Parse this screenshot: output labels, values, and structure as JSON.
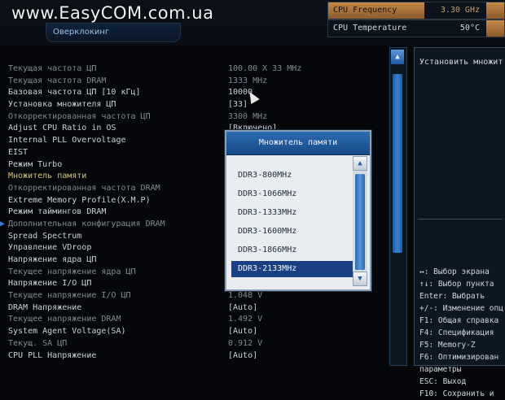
{
  "watermark": "www.EasyCOM.com.ua",
  "section_tab": "Оверклокинг",
  "status": {
    "cpu_frequency": {
      "label": "CPU Frequency",
      "value": "3.30 GHz"
    },
    "cpu_temperature": {
      "label": "CPU Temperature",
      "value": "50°C"
    }
  },
  "settings": [
    {
      "name": "Текущая частота ЦП",
      "value": "100.00 X 33 MHz"
    },
    {
      "name": "Текущая частота DRAM",
      "value": "1333 MHz"
    },
    {
      "name": "Базовая частота ЦП [10 кГц]",
      "value": "10000"
    },
    {
      "name": "Установка множителя ЦП",
      "value": "[33]"
    },
    {
      "name": "Откорректированная частота ЦП",
      "value": "3300 MHz"
    },
    {
      "name": "Adjust CPU Ratio in OS",
      "value": "[Включено]"
    },
    {
      "name": "Internal PLL Overvoltage",
      "value": ""
    },
    {
      "name": "EIST",
      "value": ""
    },
    {
      "name": "Режим Turbo",
      "value": ""
    },
    {
      "name": "Множитель памяти",
      "value": ""
    },
    {
      "name": "Откорректированная частота DRAM",
      "value": ""
    },
    {
      "name": "Extreme Memory Profile(X.M.P)",
      "value": ""
    },
    {
      "name": "Режим таймингов DRAM",
      "value": ""
    },
    {
      "name": "Дополнительная конфигурация DRAM",
      "value": ""
    },
    {
      "name": "Spread Spectrum",
      "value": ""
    },
    {
      "name": "Управление VDroop",
      "value": ""
    },
    {
      "name": "Напряжение ядра ЦП",
      "value": ""
    },
    {
      "name": "Текущее напряжение ядра ЦП",
      "value": ""
    },
    {
      "name": "Напряжение I/O ЦП",
      "value": ""
    },
    {
      "name": "Текущее напряжение I/O ЦП",
      "value": "1.048 V"
    },
    {
      "name": "DRAM Напряжение",
      "value": "[Auto]"
    },
    {
      "name": "Текущее напряжение DRAM",
      "value": "1.492 V"
    },
    {
      "name": "System Agent Voltage(SA)",
      "value": "[Auto]"
    },
    {
      "name": "Текущ. SA ЦП",
      "value": "0.912 V"
    },
    {
      "name": "CPU PLL Напряжение",
      "value": "[Auto]"
    }
  ],
  "popup": {
    "title": "Множитель памяти",
    "options": [
      "DDR3-800MHz",
      "DDR3-1066MHz",
      "DDR3-1333MHz",
      "DDR3-1600MHz",
      "DDR3-1866MHz",
      "DDR3-2133MHz"
    ],
    "selected": "DDR3-2133MHz"
  },
  "help": {
    "description": "Установить множит",
    "legend": [
      "↔: Выбор экрана",
      "↑↓: Выбор пункта",
      "Enter: Выбрать",
      "+/-: Изменение опц",
      "F1: Общая справка",
      "F4: Спецификация",
      "F5: Memory-Z",
      "F6: Оптимизирован",
      "параметры",
      "ESC: Выход",
      "F10: Сохранить и"
    ]
  }
}
